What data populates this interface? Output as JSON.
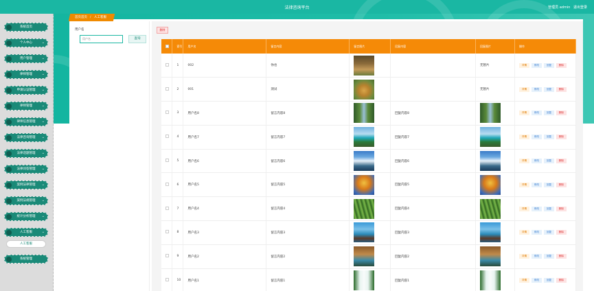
{
  "header": {
    "title": "法律咨询平台",
    "user_label": "管理员 admin",
    "logout_label": "退出登录"
  },
  "sidebar": {
    "items": [
      {
        "label": "系统首页",
        "has_chevron": false
      },
      {
        "label": "个人中心",
        "has_chevron": true
      },
      {
        "label": "用户管理",
        "has_chevron": true
      },
      {
        "label": "律师管理",
        "has_chevron": true
      },
      {
        "label": "申请认证管理",
        "has_chevron": true
      },
      {
        "label": "律师管理",
        "has_chevron": true
      },
      {
        "label": "律师信息管理",
        "has_chevron": true
      },
      {
        "label": "法律咨询管理",
        "has_chevron": true
      },
      {
        "label": "法律话题管理",
        "has_chevron": true
      },
      {
        "label": "法律问答管理",
        "has_chevron": true
      },
      {
        "label": "案例法律管理",
        "has_chevron": true
      },
      {
        "label": "案例法规管理",
        "has_chevron": true
      },
      {
        "label": "统计分析管理",
        "has_chevron": true
      },
      {
        "label": "人工客服",
        "has_chevron": true
      }
    ],
    "sub_item": "人工客服",
    "bottom_item": "系统管理"
  },
  "breadcrumb": {
    "home": "首页首页",
    "sep": "/",
    "current": "人工客服"
  },
  "search": {
    "label": "用户名",
    "placeholder": "用户名",
    "button": "查询"
  },
  "toolbar": {
    "delete_label": "删除"
  },
  "table": {
    "headers": [
      "",
      "索引",
      "用户名",
      "留言内容",
      "留言图片",
      "回复内容",
      "回复图片",
      "操作"
    ],
    "ops": {
      "detail": "详情",
      "edit": "修改",
      "reply": "回复",
      "delete": "删除"
    },
    "rows": [
      {
        "index": "1",
        "username": "002",
        "message": "你也",
        "msg_img": "img-deer",
        "reply": "",
        "reply_img": "",
        "reply_status": "无暂片"
      },
      {
        "index": "2",
        "username": "001",
        "message": "测试",
        "msg_img": "img-lion",
        "reply": "",
        "reply_img": "",
        "reply_status": "无暂片"
      },
      {
        "index": "3",
        "username": "用户名8",
        "message": "留言内容8",
        "msg_img": "img-river",
        "reply": "回复内容8",
        "reply_img": "img-river",
        "reply_status": ""
      },
      {
        "index": "4",
        "username": "用户名7",
        "message": "留言内容7",
        "msg_img": "img-beach",
        "reply": "回复内容7",
        "reply_img": "img-beach",
        "reply_status": ""
      },
      {
        "index": "5",
        "username": "用户名6",
        "message": "留言内容6",
        "msg_img": "img-waterfall",
        "reply": "回复内容6",
        "reply_img": "img-waterfall",
        "reply_status": ""
      },
      {
        "index": "6",
        "username": "用户名5",
        "message": "留言内容5",
        "msg_img": "img-autumn",
        "reply": "回复内容5",
        "reply_img": "img-autumn",
        "reply_status": ""
      },
      {
        "index": "7",
        "username": "用户名4",
        "message": "留言内容4",
        "msg_img": "img-bamboo",
        "reply": "回复内容4",
        "reply_img": "img-bamboo",
        "reply_status": ""
      },
      {
        "index": "8",
        "username": "用户名3",
        "message": "留言内容3",
        "msg_img": "img-pier",
        "reply": "回复内容3",
        "reply_img": "img-pier",
        "reply_status": ""
      },
      {
        "index": "9",
        "username": "用户名2",
        "message": "留言内容2",
        "msg_img": "img-forest",
        "reply": "回复内容2",
        "reply_img": "img-forest",
        "reply_status": ""
      },
      {
        "index": "10",
        "username": "用户名1",
        "message": "留言内容1",
        "msg_img": "img-falls",
        "reply": "回复内容1",
        "reply_img": "img-falls",
        "reply_status": ""
      }
    ]
  },
  "colors": {
    "primary": "#1ab7a3",
    "sidebar_item": "#1a8a78",
    "table_header": "#f58a07"
  }
}
